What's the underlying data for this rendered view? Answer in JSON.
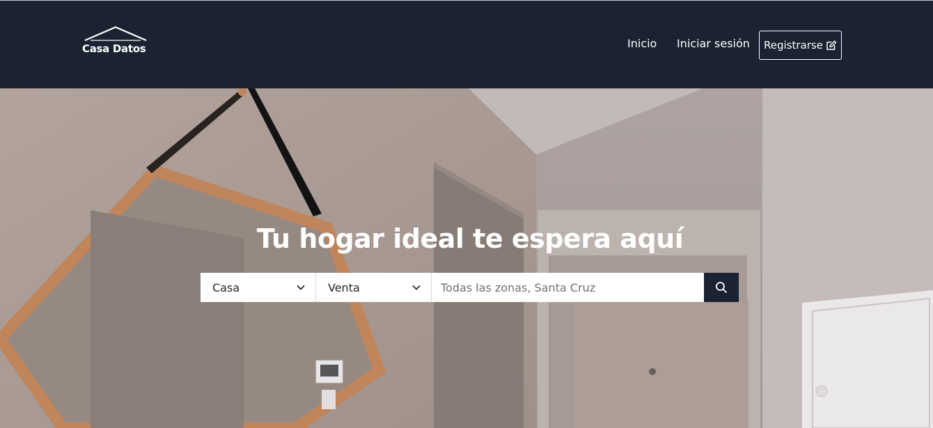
{
  "brand": {
    "name": "Casa Datos",
    "logo_icon": "house-roof-icon"
  },
  "nav": {
    "home": "Inicio",
    "login": "Iniciar sesión",
    "register": "Registrarse",
    "register_icon": "edit-icon"
  },
  "hero": {
    "title": "Tu hogar ideal te espera aquí",
    "background": "bathroom-interior-photo"
  },
  "search": {
    "property_type": "Casa",
    "operation": "Venta",
    "location_placeholder": "Todas las zonas, Santa Cruz",
    "location_value": "",
    "button_icon": "search-icon"
  },
  "colors": {
    "header_bg": "#1b2232",
    "search_button_bg": "#1b2232",
    "text_light": "#ffffff"
  }
}
